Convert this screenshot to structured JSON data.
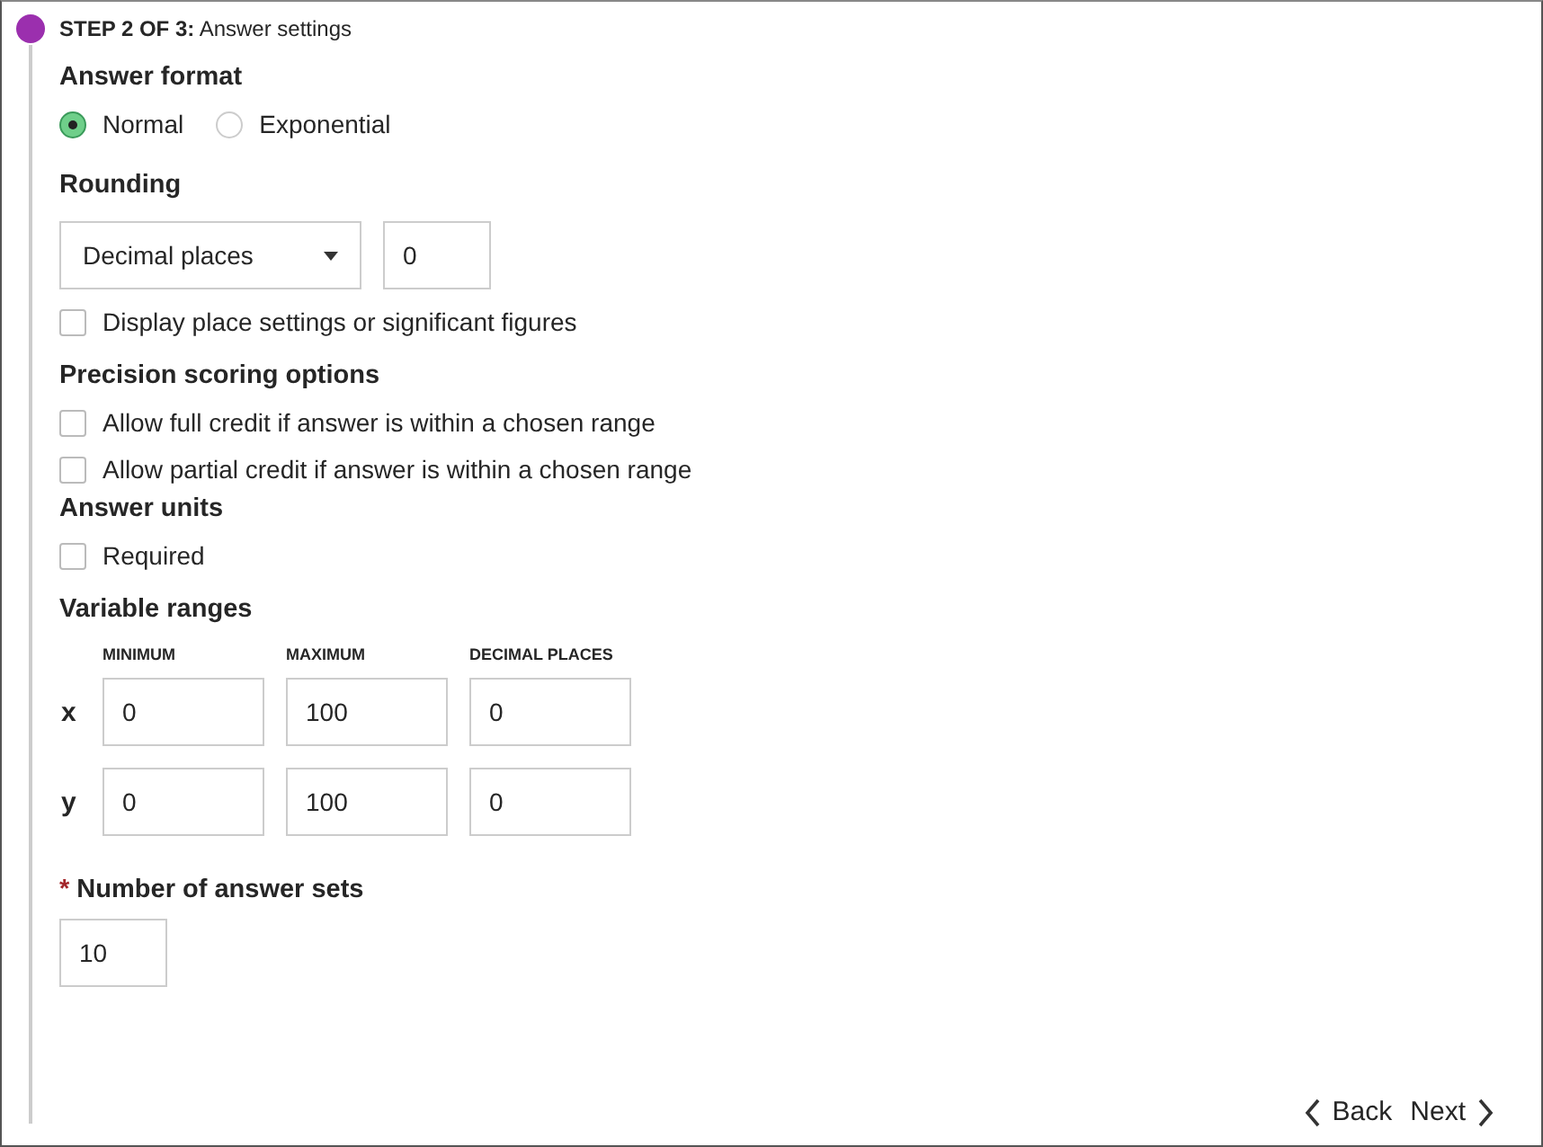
{
  "step": {
    "label": "STEP 2 OF 3:",
    "title": "Answer settings"
  },
  "answer_format": {
    "heading": "Answer format",
    "options": [
      {
        "label": "Normal",
        "selected": true
      },
      {
        "label": "Exponential",
        "selected": false
      }
    ]
  },
  "rounding": {
    "heading": "Rounding",
    "dropdown": "Decimal places",
    "value": "0",
    "options": [
      {
        "label": "Display place settings or significant figures",
        "checked": false
      }
    ]
  },
  "precision": {
    "heading": "Precision scoring options",
    "options": [
      {
        "label": "Allow full credit if answer is within a chosen range",
        "checked": false
      },
      {
        "label": "Allow partial credit if answer is within a chosen range",
        "checked": false
      }
    ]
  },
  "answer_units": {
    "heading": "Answer units",
    "options": [
      {
        "label": "Required",
        "checked": false
      }
    ]
  },
  "variable_ranges": {
    "heading": "Variable ranges",
    "columns": [
      "MINIMUM",
      "MAXIMUM",
      "DECIMAL PLACES"
    ],
    "rows": [
      {
        "name": "x",
        "values": [
          "0",
          "100",
          "0"
        ]
      },
      {
        "name": "y",
        "values": [
          "0",
          "100",
          "0"
        ]
      }
    ]
  },
  "answer_sets": {
    "required_mark": "*",
    "label": "Number of answer sets",
    "value": "10"
  },
  "nav": {
    "back": "Back",
    "next": "Next"
  }
}
